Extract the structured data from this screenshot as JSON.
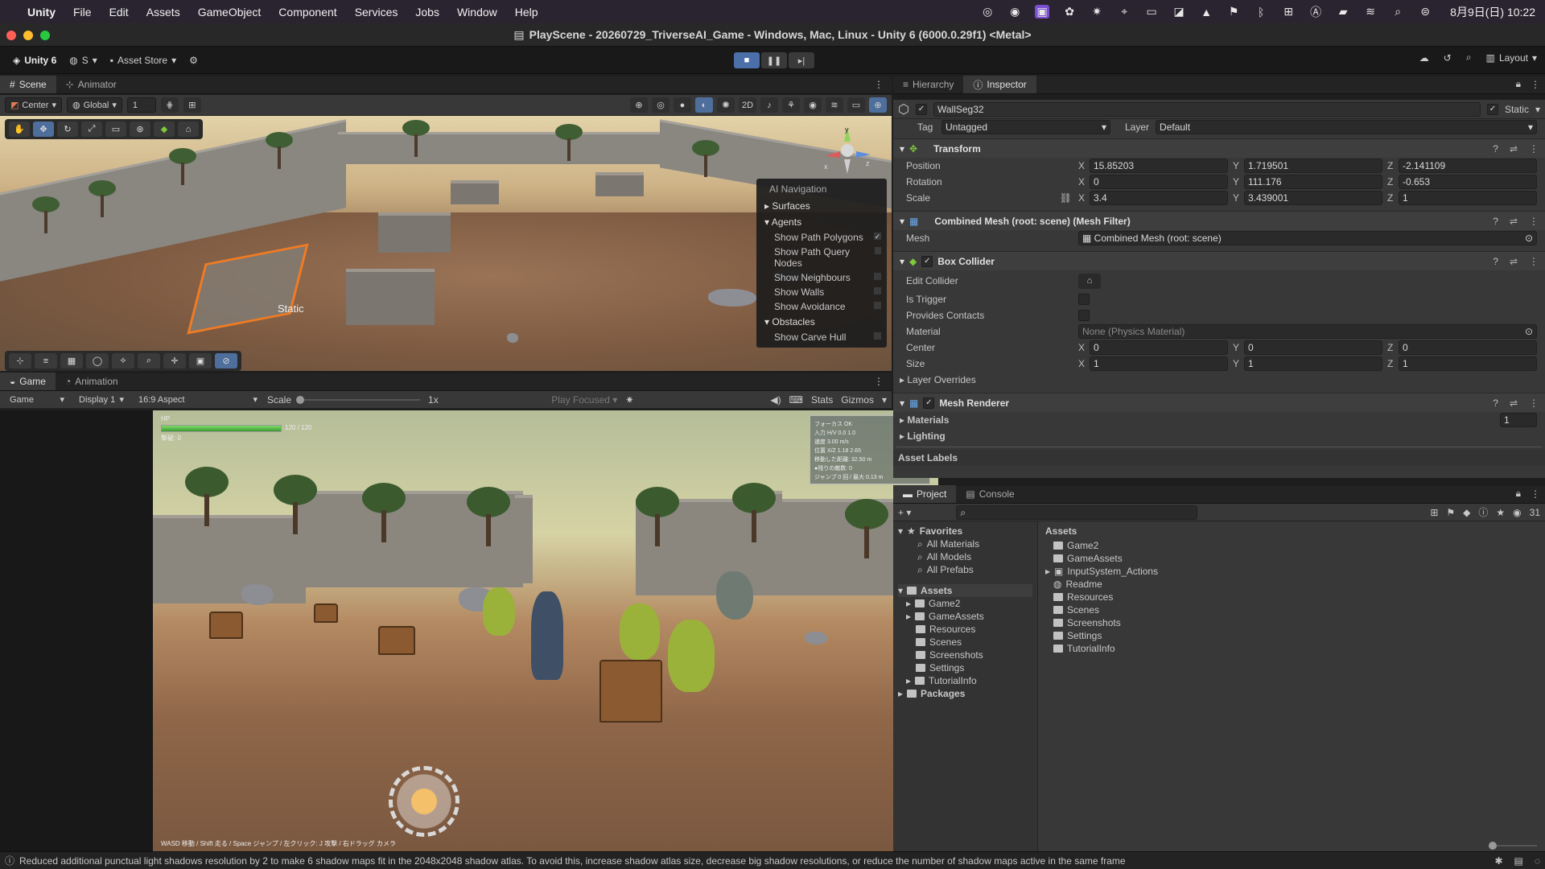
{
  "menubar": {
    "items": [
      "Unity",
      "File",
      "Edit",
      "Assets",
      "GameObject",
      "Component",
      "Services",
      "Jobs",
      "Window",
      "Help"
    ],
    "clock": "8月9日(日) 10:22"
  },
  "window": {
    "title": "PlayScene - 20260729_TriverseAI_Game - Windows, Mac, Linux - Unity 6 (6000.0.29f1) <Metal>"
  },
  "toolbar": {
    "brand": "Unity 6",
    "account": "S",
    "asset_store": "Asset Store",
    "layout": "Layout"
  },
  "scene_panel": {
    "tabs": [
      "Scene",
      "Animator"
    ],
    "pivot": "Center",
    "space": "Global",
    "grid_value": "1",
    "static_label": "Static",
    "ai_nav": {
      "title": "AI Navigation",
      "surfaces": "Surfaces",
      "agents": "Agents",
      "agent_rows": [
        "Show Path Polygons",
        "Show Path Query Nodes",
        "Show Neighbours",
        "Show Walls",
        "Show Avoidance"
      ],
      "obstacles": "Obstacles",
      "obstacle_rows": [
        "Show Carve Hull"
      ]
    }
  },
  "game_panel": {
    "tabs": [
      "Game",
      "Animation"
    ],
    "mode": "Game",
    "display": "Display 1",
    "aspect": "16:9 Aspect",
    "scale_label": "Scale",
    "scale_value": "1x",
    "play_focused": "Play Focused",
    "stats": "Stats",
    "gizmos": "Gizmos",
    "hud": {
      "hp_label": "HP",
      "hp_value": "120 / 120",
      "hp_fraction": 1.0,
      "kills": "撃破: 0",
      "stats_lines": [
        "フォーカス OK",
        "入力 H/V  0.0  1.0",
        "速度  3.00 m/s",
        "位置 X/Z  1.18  2.65",
        "移動した距離: 32.50 m",
        "●残りの敵数: 0",
        "ジャンプ  0 回 / 最大 0.13 m"
      ],
      "help": "WASD 移動 / Shift 走る / Space ジャンプ / 左クリック: J 攻撃 / 右ドラッグ カメラ"
    }
  },
  "inspector": {
    "tabs": [
      "Hierarchy",
      "Inspector"
    ],
    "object_name": "WallSeg32",
    "static_label": "Static",
    "tag_label": "Tag",
    "tag_value": "Untagged",
    "layer_label": "Layer",
    "layer_value": "Default",
    "transform": {
      "title": "Transform",
      "position_label": "Position",
      "position": {
        "x": "15.85203",
        "y": "1.719501",
        "z": "-2.141109"
      },
      "rotation_label": "Rotation",
      "rotation": {
        "x": "0",
        "y": "111.176",
        "z": "-0.653"
      },
      "scale_label": "Scale",
      "scale": {
        "x": "3.4",
        "y": "3.439001",
        "z": "1"
      }
    },
    "mesh_filter": {
      "title": "Combined Mesh (root: scene) (Mesh Filter)",
      "mesh_label": "Mesh",
      "mesh_value": "Combined Mesh (root: scene)"
    },
    "box_collider": {
      "title": "Box Collider",
      "edit_label": "Edit Collider",
      "is_trigger": "Is Trigger",
      "provides_contacts": "Provides Contacts",
      "material_label": "Material",
      "material_value": "None (Physics Material)",
      "center_label": "Center",
      "center": {
        "x": "0",
        "y": "0",
        "z": "0"
      },
      "size_label": "Size",
      "size": {
        "x": "1",
        "y": "1",
        "z": "1"
      },
      "layer_overrides": "Layer Overrides"
    },
    "mesh_renderer": {
      "title": "Mesh Renderer",
      "materials": "Materials",
      "materials_count": "1",
      "lighting": "Lighting"
    },
    "asset_labels": "Asset Labels"
  },
  "project": {
    "tabs": [
      "Project",
      "Console"
    ],
    "favorites": "Favorites",
    "favorite_items": [
      "All Materials",
      "All Models",
      "All Prefabs"
    ],
    "assets": "Assets",
    "asset_tree": [
      "Game2",
      "GameAssets",
      "Resources",
      "Scenes",
      "Screenshots",
      "Settings",
      "TutorialInfo"
    ],
    "packages": "Packages",
    "right_header": "Assets",
    "right_items": [
      "Game2",
      "GameAssets",
      "InputSystem_Actions",
      "Readme",
      "Resources",
      "Scenes",
      "Screenshots",
      "Settings",
      "TutorialInfo"
    ],
    "count": "31"
  },
  "status": {
    "message": "Reduced additional punctual light shadows resolution by 2 to make 6 shadow maps fit in the 2048x2048 shadow atlas. To avoid this, increase shadow atlas size, decrease big shadow resolutions, or reduce the number of shadow maps active in the same frame"
  }
}
